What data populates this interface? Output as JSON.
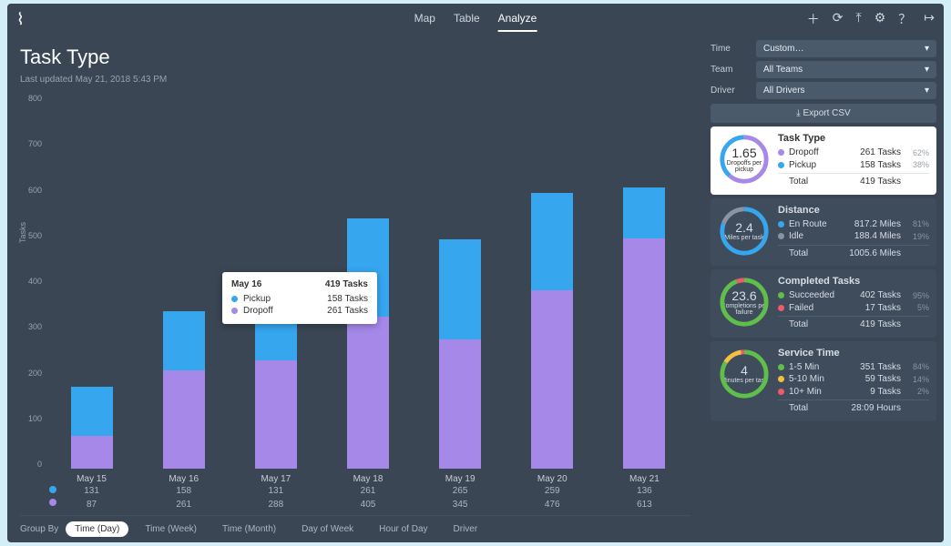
{
  "nav": {
    "map": "Map",
    "table": "Table",
    "analyze": "Analyze"
  },
  "title": "Task Type",
  "subtitle": "Last updated May 21, 2018 5:43 PM",
  "ylabel": "Tasks",
  "groupby_label": "Group By",
  "group_options": [
    "Time (Day)",
    "Time (Week)",
    "Time (Month)",
    "Day of Week",
    "Hour of Day",
    "Driver"
  ],
  "filters": {
    "time_label": "Time",
    "time_value": "Custom…",
    "team_label": "Team",
    "team_value": "All Teams",
    "driver_label": "Driver",
    "driver_value": "All Drivers"
  },
  "export_label": "Export CSV",
  "tooltip": {
    "title": "May 16",
    "total": "419 Tasks",
    "r1_label": "Pickup",
    "r1_value": "158 Tasks",
    "r2_label": "Dropoff",
    "r2_value": "261 Tasks"
  },
  "cards": {
    "tasktype": {
      "title": "Task Type",
      "metric": "1.65",
      "metric_sub": "Dropoffs per pickup",
      "dropoff_label": "Dropoff",
      "dropoff_val": "261 Tasks",
      "dropoff_pct": "62%",
      "pickup_label": "Pickup",
      "pickup_val": "158 Tasks",
      "pickup_pct": "38%",
      "total_label": "Total",
      "total_val": "419 Tasks"
    },
    "distance": {
      "title": "Distance",
      "metric": "2.4",
      "metric_sub": "Miles per task",
      "enroute_label": "En Route",
      "enroute_val": "817.2 Miles",
      "enroute_pct": "81%",
      "idle_label": "Idle",
      "idle_val": "188.4 Miles",
      "idle_pct": "19%",
      "total_label": "Total",
      "total_val": "1005.6 Miles"
    },
    "completed": {
      "title": "Completed Tasks",
      "metric": "23.6",
      "metric_sub": "Completions per failure",
      "succ_label": "Succeeded",
      "succ_val": "402 Tasks",
      "succ_pct": "95%",
      "fail_label": "Failed",
      "fail_val": "17 Tasks",
      "fail_pct": "5%",
      "total_label": "Total",
      "total_val": "419 Tasks"
    },
    "service": {
      "title": "Service Time",
      "metric": "4",
      "metric_sub": "Minutes per task",
      "a_label": "1-5 Min",
      "a_val": "351 Tasks",
      "a_pct": "84%",
      "b_label": "5-10 Min",
      "b_val": "59 Tasks",
      "b_pct": "14%",
      "c_label": "10+ Min",
      "c_val": "9 Tasks",
      "c_pct": "2%",
      "total_label": "Total",
      "total_val": "28:09 Hours"
    }
  },
  "chart_data": {
    "type": "bar",
    "stacked": true,
    "ylabel": "Tasks",
    "ylim": [
      0,
      800
    ],
    "yticks": [
      800,
      700,
      600,
      500,
      400,
      300,
      200,
      100,
      0
    ],
    "categories": [
      "May 15",
      "May 16",
      "May 17",
      "May 18",
      "May 19",
      "May 20",
      "May 21"
    ],
    "series": [
      {
        "name": "Pickup",
        "color": "#36a6ef",
        "values": [
          131,
          158,
          131,
          261,
          265,
          259,
          136
        ]
      },
      {
        "name": "Dropoff",
        "color": "#a588e8",
        "values": [
          87,
          261,
          288,
          405,
          345,
          476,
          613
        ]
      }
    ],
    "value_rows": [
      {
        "series": "Pickup",
        "values": [
          "131",
          "158",
          "131",
          "261",
          "265",
          "259",
          "136"
        ]
      },
      {
        "series": "Dropoff",
        "values": [
          "87",
          "261",
          "288",
          "405",
          "345",
          "476",
          "613"
        ]
      }
    ]
  }
}
